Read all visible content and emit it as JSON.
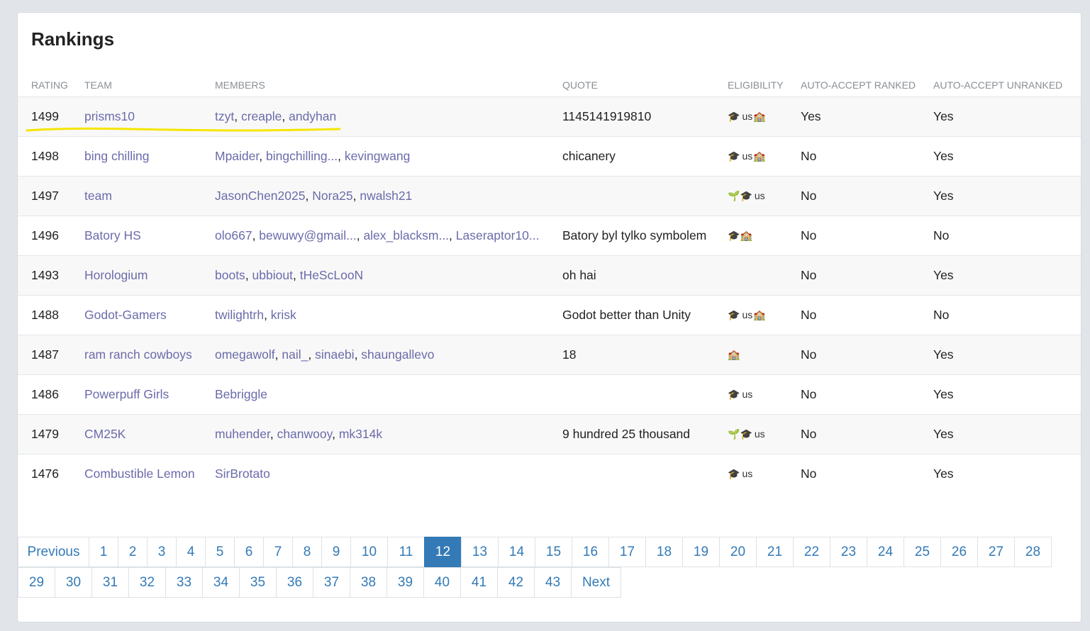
{
  "title": "Rankings",
  "columns": [
    "RATING",
    "TEAM",
    "MEMBERS",
    "QUOTE",
    "ELIGIBILITY",
    "AUTO-ACCEPT RANKED",
    "AUTO-ACCEPT UNRANKED"
  ],
  "rows": [
    {
      "rating": "1499",
      "team": "prisms10",
      "members": [
        "tzyt",
        "creaple",
        "andyhan"
      ],
      "quote": "1145141919810",
      "elig": [
        "cap",
        "us",
        "school"
      ],
      "ranked": "Yes",
      "unranked": "Yes"
    },
    {
      "rating": "1498",
      "team": "bing chilling",
      "members": [
        "Mpaider",
        "bingchilling...",
        "kevingwang"
      ],
      "quote": "chicanery",
      "elig": [
        "cap",
        "us",
        "school"
      ],
      "ranked": "No",
      "unranked": "Yes"
    },
    {
      "rating": "1497",
      "team": "team",
      "members": [
        "JasonChen2025",
        "Nora25",
        "nwalsh21"
      ],
      "quote": "",
      "elig": [
        "sprout",
        "cap",
        "us"
      ],
      "ranked": "No",
      "unranked": "Yes"
    },
    {
      "rating": "1496",
      "team": "Batory HS",
      "members": [
        "olo667",
        "bewuwy@gmail...",
        "alex_blacksm...",
        "Laseraptor10..."
      ],
      "quote": "Batory byl tylko symbolem",
      "elig": [
        "cap",
        "school"
      ],
      "ranked": "No",
      "unranked": "No"
    },
    {
      "rating": "1493",
      "team": "Horologium",
      "members": [
        "boots",
        "ubbiout",
        "tHeScLooN"
      ],
      "quote": "oh hai",
      "elig": [],
      "ranked": "No",
      "unranked": "Yes"
    },
    {
      "rating": "1488",
      "team": "Godot-Gamers",
      "members": [
        "twilightrh",
        "krisk"
      ],
      "quote": "Godot better than Unity",
      "elig": [
        "cap",
        "us",
        "school"
      ],
      "ranked": "No",
      "unranked": "No"
    },
    {
      "rating": "1487",
      "team": "ram ranch cowboys",
      "members": [
        "omegawolf",
        "nail_",
        "sinaebi",
        "shaungallevo"
      ],
      "quote": "18",
      "elig": [
        "school"
      ],
      "ranked": "No",
      "unranked": "Yes"
    },
    {
      "rating": "1486",
      "team": "Powerpuff Girls",
      "members": [
        "Bebriggle"
      ],
      "quote": "",
      "elig": [
        "cap",
        "us"
      ],
      "ranked": "No",
      "unranked": "Yes"
    },
    {
      "rating": "1479",
      "team": "CM25K",
      "members": [
        "muhender",
        "chanwooy",
        "mk314k"
      ],
      "quote": "9 hundred 25 thousand",
      "elig": [
        "sprout",
        "cap",
        "us"
      ],
      "ranked": "No",
      "unranked": "Yes"
    },
    {
      "rating": "1476",
      "team": "Combustible Lemon",
      "members": [
        "SirBrotato"
      ],
      "quote": "",
      "elig": [
        "cap",
        "us"
      ],
      "ranked": "No",
      "unranked": "Yes"
    }
  ],
  "pagination": {
    "previous": "Previous",
    "next": "Next",
    "active": "12",
    "row1": [
      "1",
      "2",
      "3",
      "4",
      "5",
      "6",
      "7",
      "8",
      "9",
      "10",
      "11",
      "12",
      "13",
      "14",
      "15",
      "16",
      "17",
      "18",
      "19",
      "20",
      "21",
      "22",
      "23",
      "24",
      "25",
      "26",
      "27",
      "28"
    ],
    "row2": [
      "29",
      "30",
      "31",
      "32",
      "33",
      "34",
      "35",
      "36",
      "37",
      "38",
      "39",
      "40",
      "41",
      "42",
      "43"
    ]
  },
  "elig_icons": {
    "cap": "🎓",
    "us": "us",
    "school": "🏫",
    "sprout": "🌱"
  },
  "colors": {
    "link": "#6b6bab",
    "accent": "#337ab7",
    "highlight_underline": "#f5e600"
  }
}
